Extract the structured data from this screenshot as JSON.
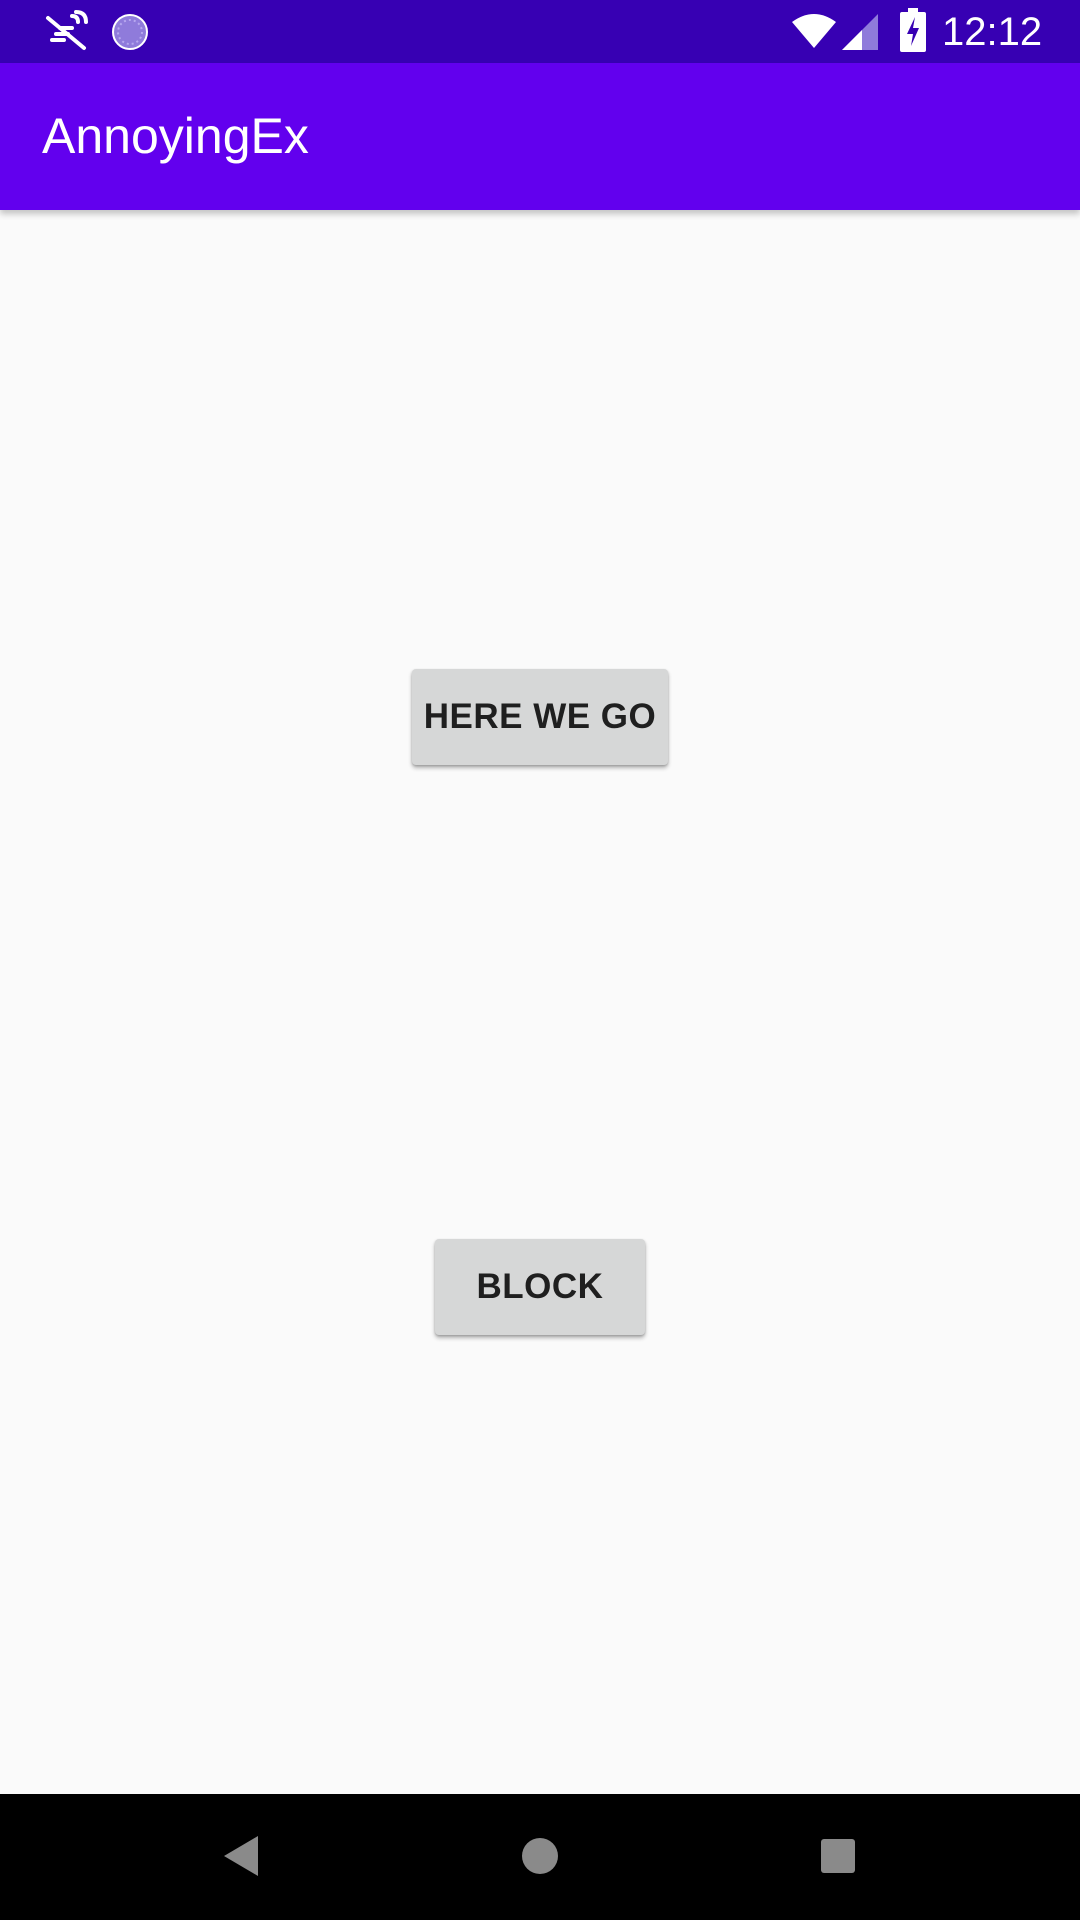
{
  "status_bar": {
    "time": "12:12",
    "left_icons": [
      "notifications-off-icon",
      "sync-progress-icon"
    ],
    "right_icons": [
      "wifi-icon",
      "cell-signal-icon",
      "battery-charging-icon"
    ]
  },
  "app_bar": {
    "title": "AnnoyingEx",
    "color": "#6200ee"
  },
  "main": {
    "here_we_go_label": "HERE WE GO",
    "block_label": "BLOCK"
  },
  "nav_bar": {
    "icons": [
      "back-icon",
      "home-icon",
      "recents-icon"
    ]
  },
  "colors": {
    "status_bar": "#3700b3",
    "app_bar": "#6200ee",
    "background": "#fafafa",
    "button": "#d6d7d7"
  }
}
